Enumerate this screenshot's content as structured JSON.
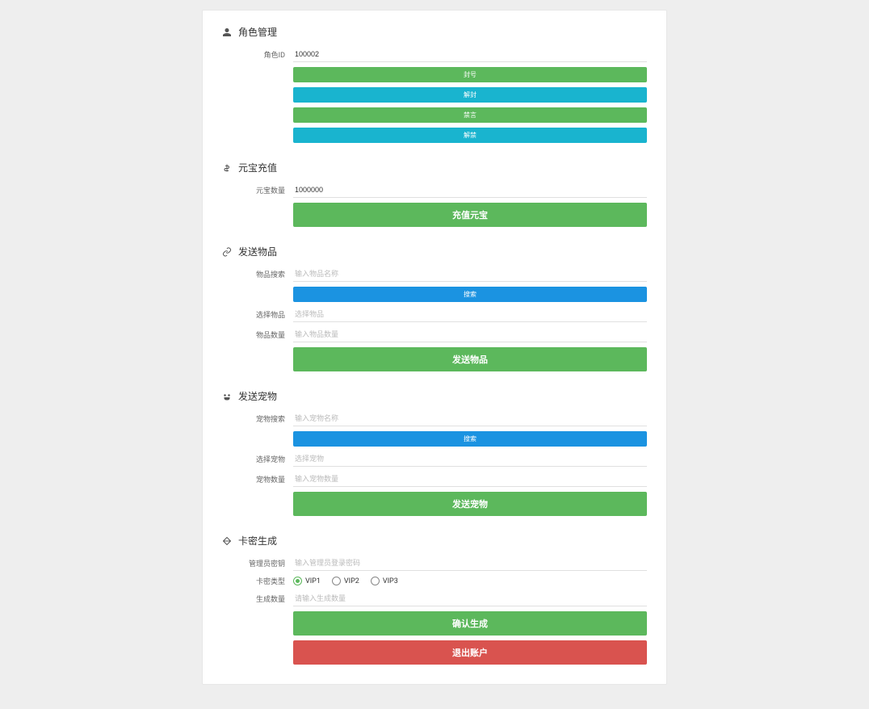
{
  "role": {
    "heading": "角色管理",
    "id_label": "角色ID",
    "id_value": "100002",
    "btn_ban": "封号",
    "btn_unban": "解封",
    "btn_mute": "禁言",
    "btn_unmute": "解禁"
  },
  "gold": {
    "heading": "元宝充值",
    "label": "元宝数量",
    "value": "1000000",
    "btn": "充值元宝"
  },
  "item": {
    "heading": "发送物品",
    "search_label": "物品搜索",
    "search_placeholder": "输入物品名称",
    "search_btn": "搜索",
    "select_label": "选择物品",
    "select_placeholder": "选择物品",
    "qty_label": "物品数量",
    "qty_placeholder": "输入物品数量",
    "send_btn": "发送物品"
  },
  "pet": {
    "heading": "发送宠物",
    "search_label": "宠物搜索",
    "search_placeholder": "输入宠物名称",
    "search_btn": "搜索",
    "select_label": "选择宠物",
    "select_placeholder": "选择宠物",
    "qty_label": "宠物数量",
    "qty_placeholder": "输入宠物数量",
    "send_btn": "发送宠物"
  },
  "card": {
    "heading": "卡密生成",
    "pwd_label": "管理员密钥",
    "pwd_placeholder": "输入管理员登录密码",
    "type_label": "卡密类型",
    "type_options": [
      "VIP1",
      "VIP2",
      "VIP3"
    ],
    "type_selected": "VIP1",
    "qty_label": "生成数量",
    "qty_placeholder": "请输入生成数量",
    "confirm_btn": "确认生成",
    "logout_btn": "退出账户"
  }
}
